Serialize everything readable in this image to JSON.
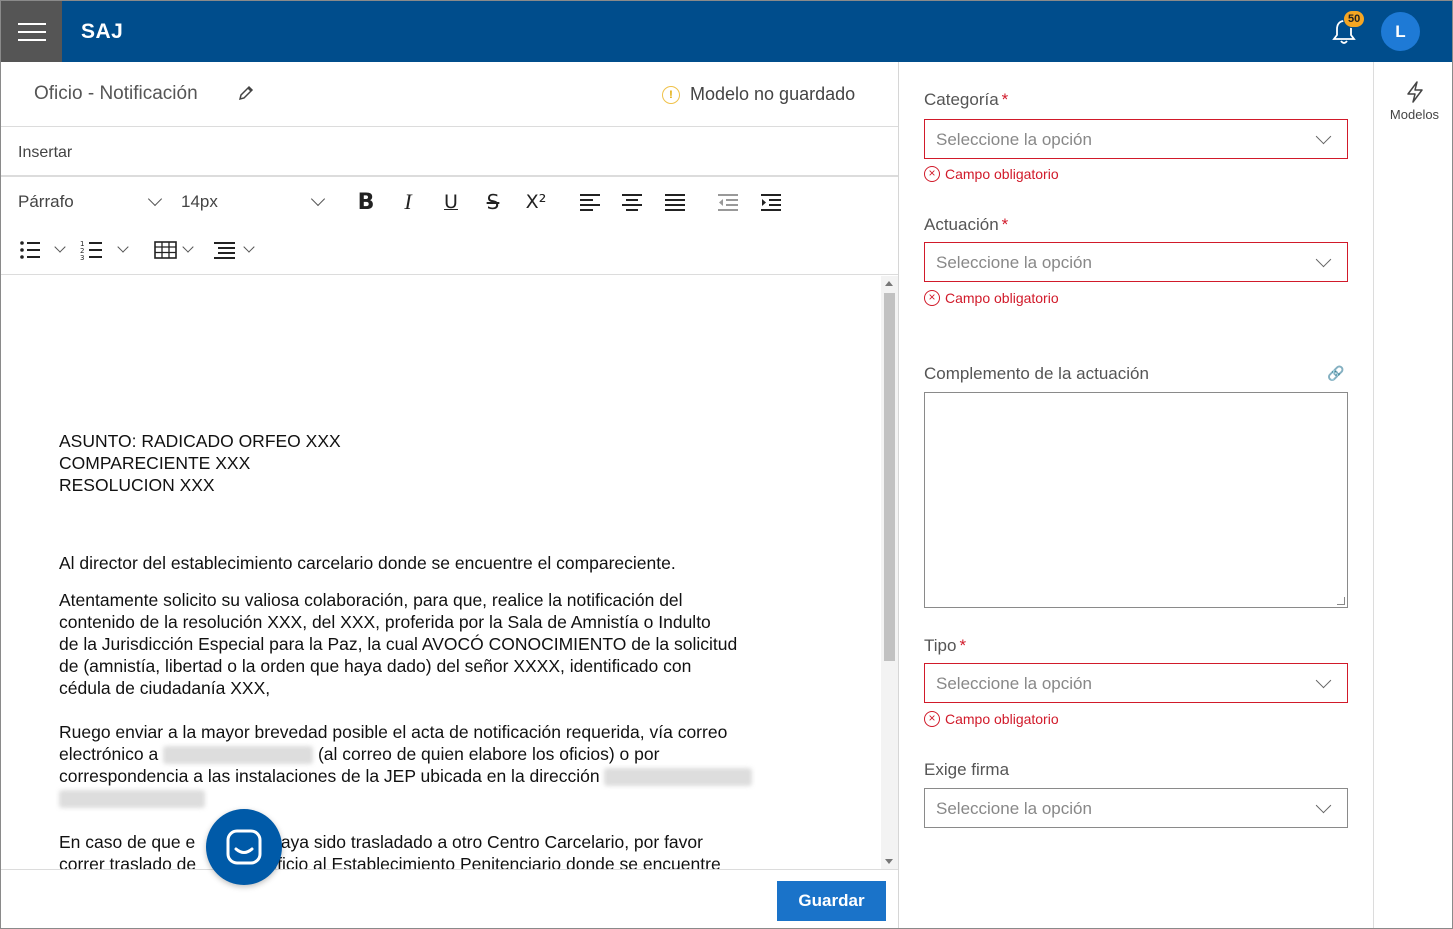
{
  "app": {
    "brand": "SAJ",
    "notifications_count": "50",
    "user_initial": "L"
  },
  "document": {
    "title": "Oficio - Notificación",
    "status": "Modelo no guardado",
    "menu_insert": "Insertar",
    "toolbar": {
      "block_format": "Párrafo",
      "font_size": "14px"
    },
    "body": {
      "asunto": "ASUNTO: RADICADO ORFEO XXX",
      "compareciente": "COMPARECIENTE XXX",
      "resolucion": "RESOLUCION XXX",
      "p1": "Al director del establecimiento carcelario donde se encuentre el compareciente.",
      "p2_l1": "Atentamente solicito su valiosa colaboración, para que, realice la notificación del",
      "p2_l2": "contenido de la resolución XXX, del XXX, proferida por la Sala de Amnistía o Indulto",
      "p2_l3": "de la Jurisdicción Especial para la Paz, la cual AVOCÓ CONOCIMIENTO de la solicitud",
      "p2_l4": "de (amnistía, libertad o la orden que haya dado) del señor XXXX, identificado con",
      "p2_l5": "cédula de ciudadanía XXX,",
      "p3_l1": "Ruego enviar a la mayor brevedad posible el acta de notificación requerida, vía correo",
      "p3_l2a": "electrónico a ",
      "p3_l2b": " (al correo de quien elabore los oficios) o por",
      "p3_l3": "correspondencia a las instalaciones de la JEP ubicada en la dirección ",
      "p4_l1a": "En caso de que e",
      "p4_l1b": " haya sido trasladado a otro Centro Carcelario, por favor",
      "p4_l2a": "correr traslado de",
      "p4_l2b": "nte oficio al Establecimiento Penitenciario donde se encuentre"
    },
    "save_label": "Guardar"
  },
  "form": {
    "categoria": {
      "label": "Categoría",
      "placeholder": "Seleccione la opción",
      "error": "Campo obligatorio"
    },
    "actuacion": {
      "label": "Actuación",
      "placeholder": "Seleccione la opción",
      "error": "Campo obligatorio"
    },
    "complemento": {
      "label": "Complemento de la actuación"
    },
    "tipo": {
      "label": "Tipo",
      "placeholder": "Seleccione la opción",
      "error": "Campo obligatorio"
    },
    "exige_firma": {
      "label": "Exige firma",
      "placeholder": "Seleccione la opción"
    }
  },
  "side": {
    "models_label": "Modelos"
  },
  "colors": {
    "topbar": "#004d8c",
    "error": "#d11a2a",
    "primary_button": "#1a73c9",
    "badge": "#f5a623"
  }
}
